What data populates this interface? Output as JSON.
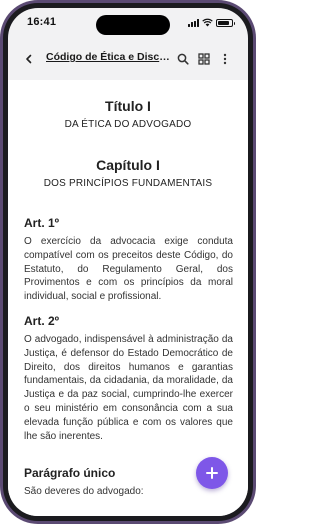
{
  "status_bar": {
    "time": "16:41"
  },
  "app_bar": {
    "title": "Código de Ética e Disciplina da OAB"
  },
  "content": {
    "titulo": "Título I",
    "titulo_sub": "DA ÉTICA DO ADVOGADO",
    "capitulo": "Capítulo I",
    "capitulo_sub": "DOS PRINCÍPIOS FUNDAMENTAIS",
    "art1_heading": "Art. 1º",
    "art1_text": "O exercício da advocacia exige conduta compatível com os preceitos deste Código, do Estatuto, do Regulamento Geral, dos Provimentos e com os princípios da moral individual, social e profissional.",
    "art2_heading": "Art. 2º",
    "art2_text": "O advogado, indispensável à administração da Justiça, é defensor do Estado Democrático de Direito, dos direitos humanos e garantias fundamentais, da cidadania, da moralidade, da Justiça e da paz social, cumprindo-lhe exercer o seu ministério em consonância com a sua elevada função pública e com os valores que lhe são inerentes.",
    "paragrafo_heading": "Parágrafo único",
    "paragrafo_text": "São deveres do advogado:"
  },
  "icons": {
    "back": "arrow-back-icon",
    "search": "search-icon",
    "grid": "grid-icon",
    "more": "more-vert-icon",
    "fab": "plus-icon"
  },
  "colors": {
    "accent": "#7e57e8",
    "frame": "#5b4a73"
  }
}
